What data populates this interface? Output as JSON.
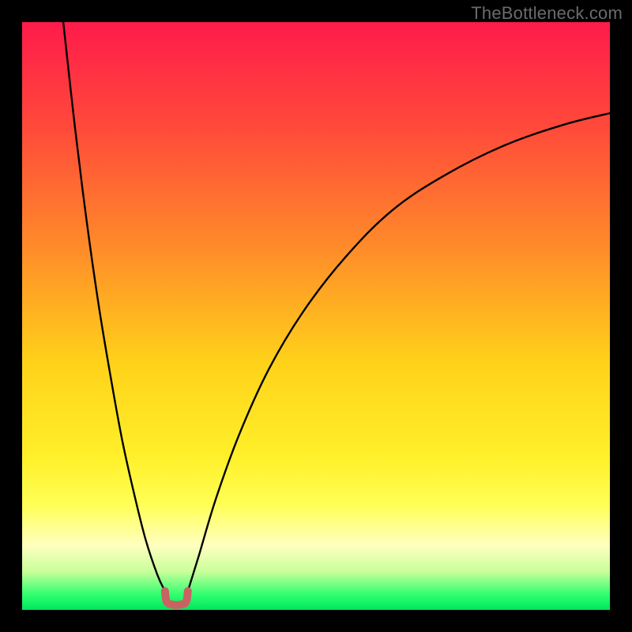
{
  "watermark": "TheBottleneck.com",
  "chart_data": {
    "type": "line",
    "title": "",
    "xlabel": "",
    "ylabel": "",
    "xlim": [
      0,
      100
    ],
    "ylim": [
      0,
      100
    ],
    "grid": false,
    "legend": false,
    "gradient_stops": [
      {
        "offset": 0,
        "color": "#ff1b4b"
      },
      {
        "offset": 0.18,
        "color": "#ff4a3a"
      },
      {
        "offset": 0.38,
        "color": "#ff8a2a"
      },
      {
        "offset": 0.58,
        "color": "#ffd21a"
      },
      {
        "offset": 0.74,
        "color": "#fff02a"
      },
      {
        "offset": 0.82,
        "color": "#ffff55"
      },
      {
        "offset": 0.89,
        "color": "#ffffc0"
      },
      {
        "offset": 0.935,
        "color": "#c8ff9a"
      },
      {
        "offset": 0.975,
        "color": "#2dff6f"
      },
      {
        "offset": 1.0,
        "color": "#00e55e"
      }
    ],
    "series": [
      {
        "name": "left-branch",
        "x": [
          7.0,
          9.0,
          11.0,
          13.0,
          15.0,
          17.0,
          19.0,
          21.0,
          23.0,
          24.3
        ],
        "y": [
          100,
          82,
          66,
          52,
          40,
          29,
          20,
          12,
          6,
          3.2
        ]
      },
      {
        "name": "right-branch",
        "x": [
          28.2,
          30.0,
          33.0,
          37.0,
          42.0,
          48.0,
          55.0,
          63.0,
          72.0,
          82.0,
          92.0,
          100.0
        ],
        "y": [
          3.2,
          9,
          19,
          30,
          41,
          51,
          60,
          68,
          74,
          79,
          82.5,
          84.5
        ]
      }
    ],
    "bottom_marker": {
      "name": "u-marker",
      "color": "#c96363",
      "stroke_width": 10,
      "points_x": [
        24.3,
        24.6,
        25.6,
        27.0,
        27.9,
        28.2
      ],
      "points_y": [
        3.2,
        1.4,
        0.9,
        0.9,
        1.4,
        3.2
      ]
    }
  }
}
